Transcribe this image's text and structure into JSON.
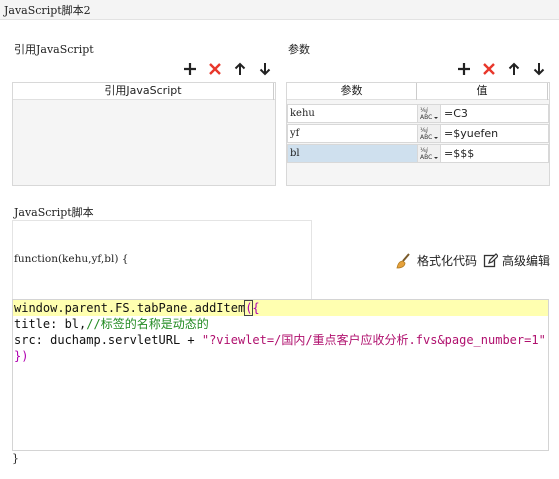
{
  "window": {
    "title": "JavaScript脚本2"
  },
  "refs": {
    "section_label": "引用JavaScript",
    "column_header": "引用JavaScript",
    "rows": []
  },
  "params": {
    "section_label": "参数",
    "columns": {
      "name": "参数",
      "value": "值"
    },
    "rows": [
      {
        "name": "kehu",
        "value": "=C3",
        "selected": false
      },
      {
        "name": "yf",
        "value": "=$yuefen",
        "selected": false
      },
      {
        "name": "bl",
        "value": "=$$$",
        "selected": true
      }
    ]
  },
  "script": {
    "section_label": "JavaScript脚本",
    "signature": "function(kehu,yf,bl) {",
    "format_label": "格式化代码",
    "advanced_label": "高级编辑",
    "closing_brace": "}",
    "code": {
      "line1_text": "window.parent.FS.tabPane.addItem",
      "line1_open_paren": "(",
      "line1_brace": "{",
      "line2_text": "title: bl,",
      "line2_comment": "//标签的名称是动态的",
      "line3_text": "src: duchamp.servletURL + ",
      "line3_string": "\"?viewlet=/国内/重点客户应收分析.fvs&page_number=1\"",
      "line4_text": "})"
    }
  },
  "icons": {
    "add": "plus-icon",
    "remove": "x-icon",
    "up": "arrow-up-icon",
    "down": "arrow-down-icon",
    "type": "formula-type-icon",
    "format": "broom-icon",
    "edit": "edit-icon"
  },
  "colors": {
    "remove": "#e8372b",
    "selected_row": "#cfe0ee",
    "active_line": "#ffffb0",
    "comment": "#228b22",
    "string": "#b0106e",
    "broom": "#e6a23c"
  }
}
